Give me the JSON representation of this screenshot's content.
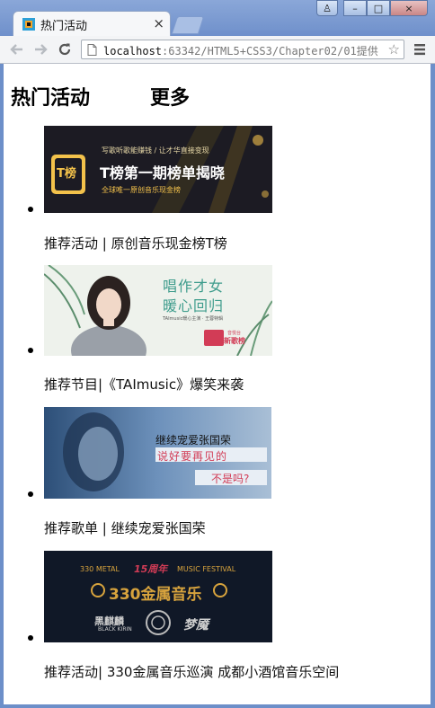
{
  "browser": {
    "tab_title": "热门活动",
    "tab_close": "×",
    "url_host": "localhost",
    "url_rest": ":63342/HTML5+CSS3/Chapter02/01提供",
    "win_user": "♙",
    "win_min": "–",
    "win_max": "□",
    "win_close": "×"
  },
  "page": {
    "heading_left": "热门活动",
    "heading_right": "更多",
    "items": [
      {
        "banner_top": "写歌听歌能赚钱 / 让才华直接变现",
        "banner_title": "T榜第一期榜单揭晓",
        "banner_sub": "全球唯一原创音乐现金榜",
        "logo": "T榜",
        "caption": "推荐活动 | 原创音乐现金榜T榜"
      },
      {
        "banner_title_1": "唱作才女",
        "banner_title_2": "暖心回归",
        "banner_sub": "TAImusic暖心主演 · 王蓉特辑",
        "badge": "新歌榜",
        "badge_top": "音悦台",
        "caption": "推荐节目|《TAImusic》爆笑来袭"
      },
      {
        "banner_title_1": "继续宠爱张国荣",
        "banner_title_2": "说好要再见的",
        "banner_title_3": "不是吗?",
        "caption": "推荐歌单 | 继续宠爱张国荣"
      },
      {
        "banner_top": "330 METAL",
        "banner_top_right": "MUSIC FESTIVAL",
        "banner_badge": "15周年",
        "banner_title": "330金属音乐",
        "band_1": "BLACK KIRIN",
        "band_2": "黑麒麟",
        "band_3": "梦魇",
        "caption": "推荐活动| 330金属音乐巡演 成都小酒馆音乐空间"
      }
    ]
  },
  "colors": {
    "frame": "#6d8fc9",
    "tbang_bg": "#1b1a22",
    "tbang_gold": "#f3c24b",
    "teal_text": "#3e9c8c",
    "pink_banner": "#d23c56",
    "metal_gold": "#d7a33d"
  }
}
